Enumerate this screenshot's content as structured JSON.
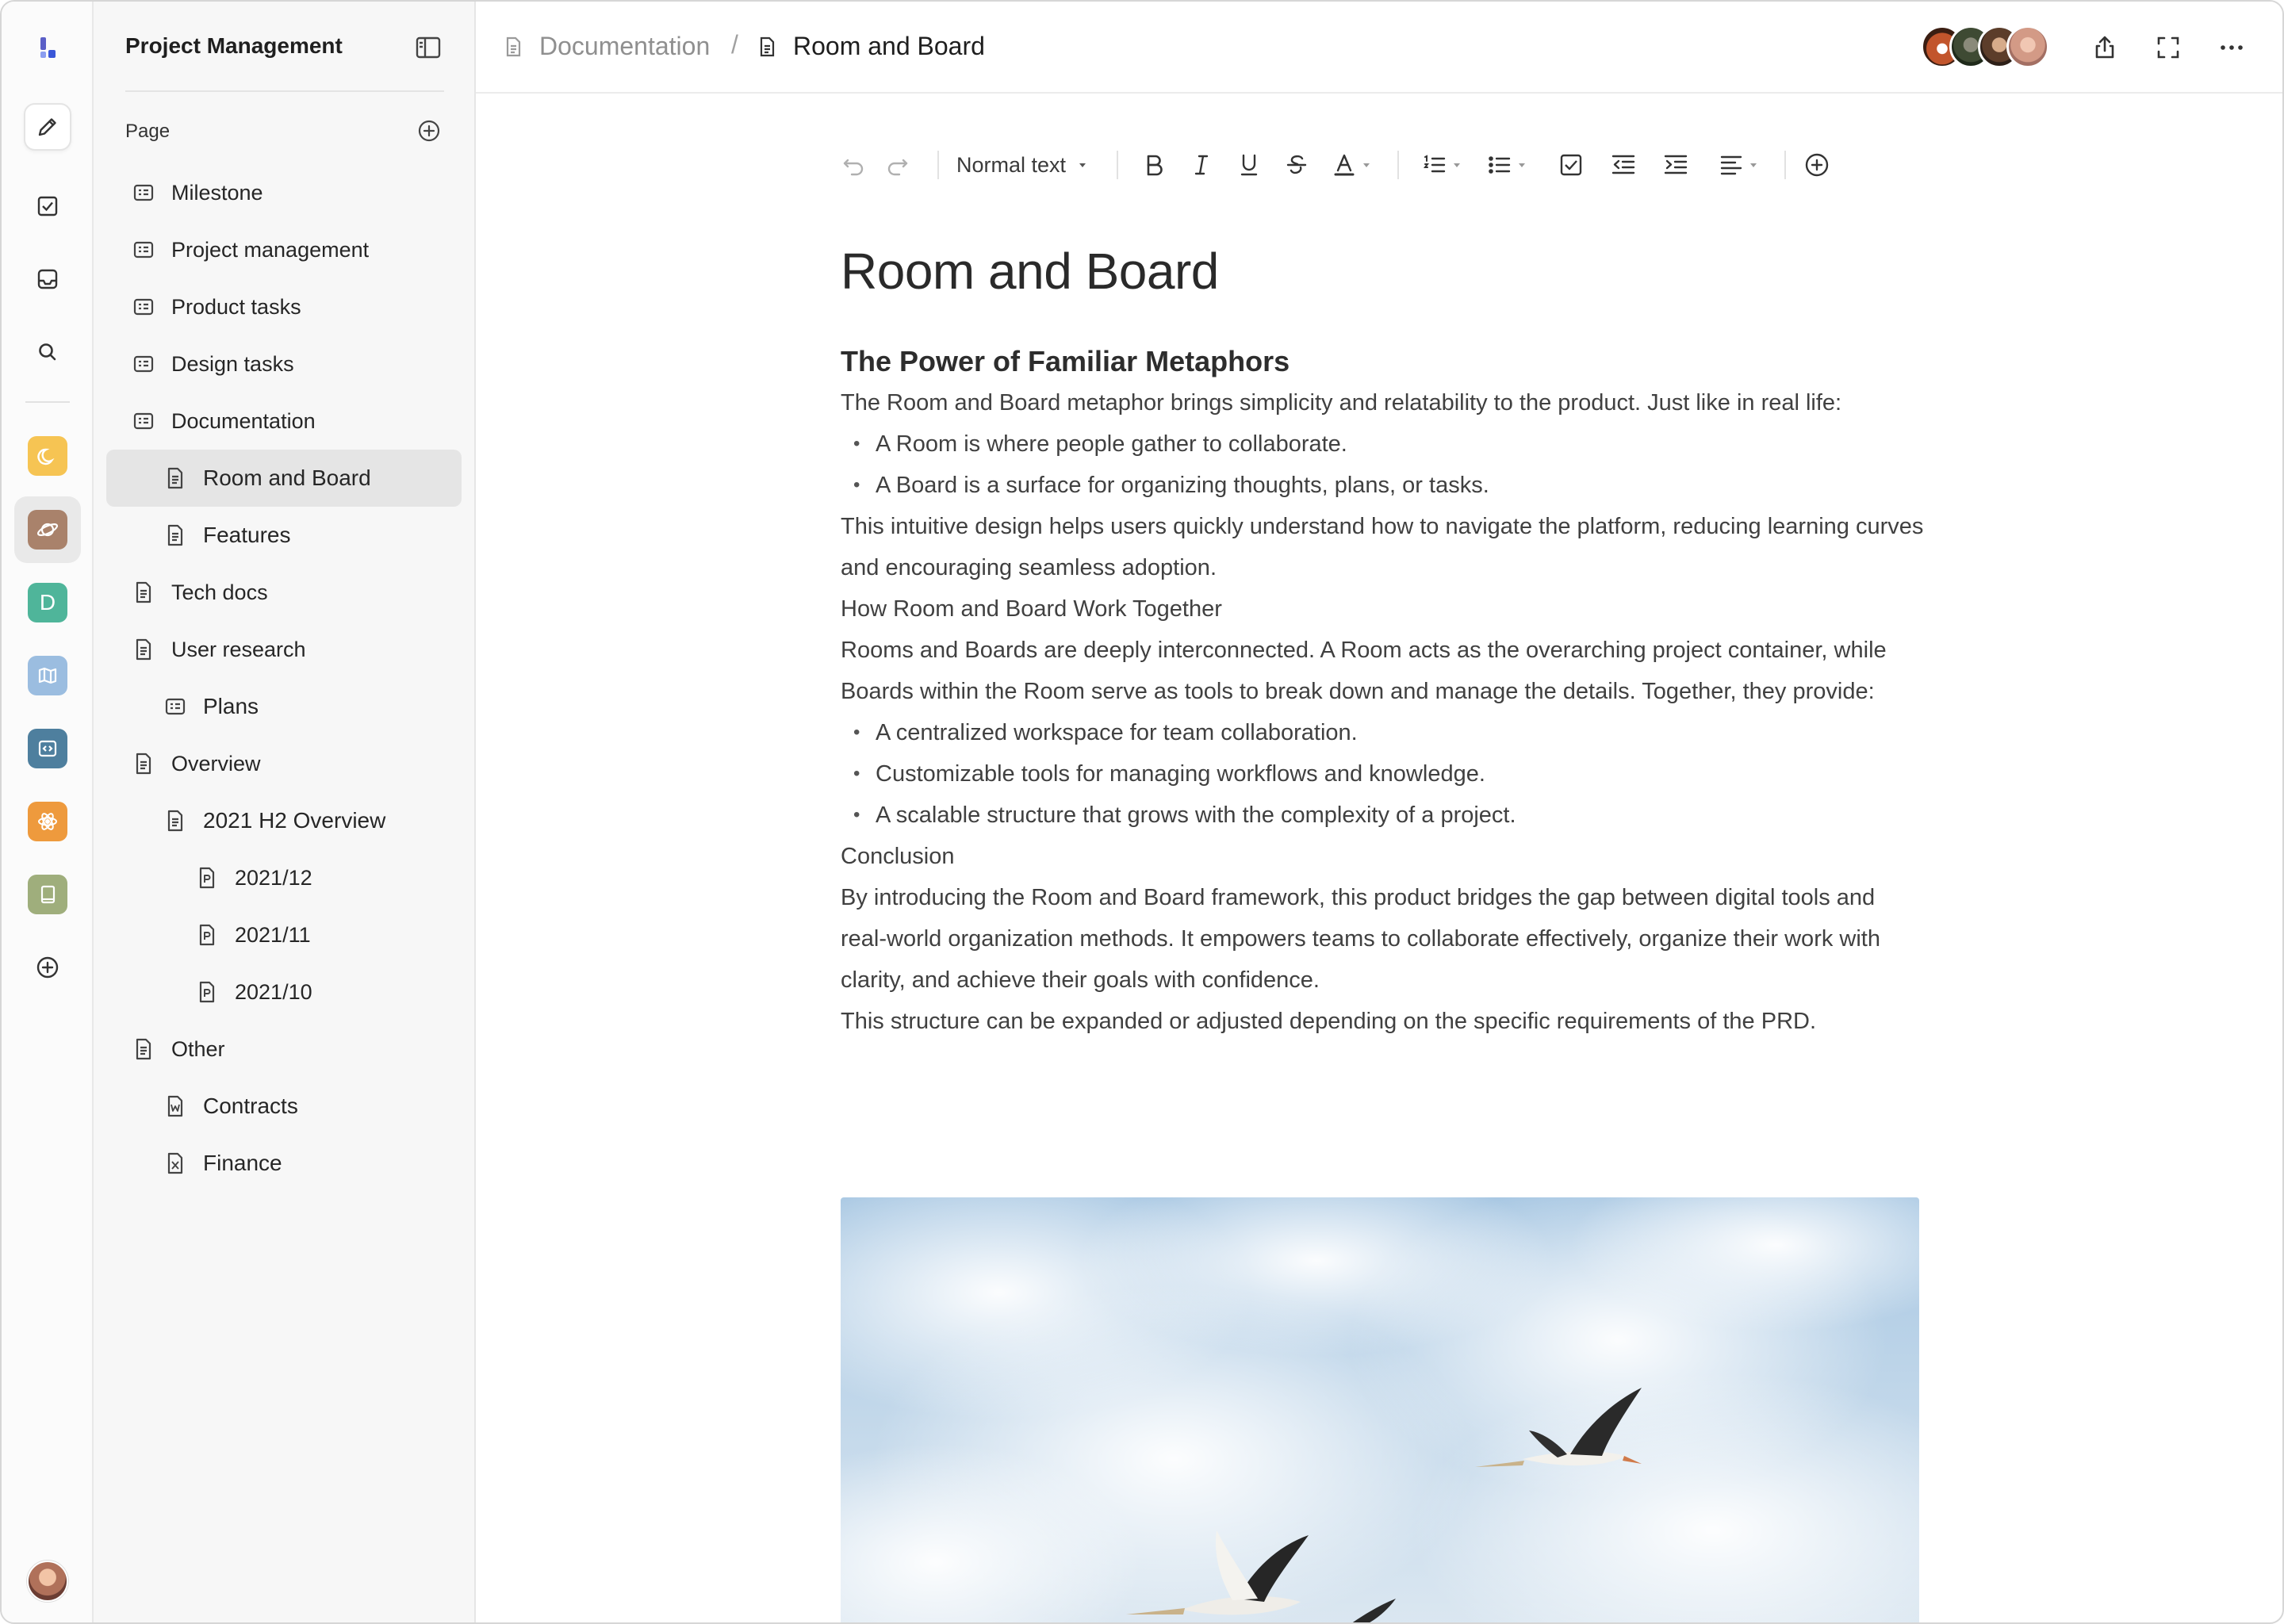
{
  "workspace": {
    "title": "Project Management"
  },
  "rail": {
    "items": [
      {
        "name": "logo"
      },
      {
        "name": "edit"
      },
      {
        "name": "tasks"
      },
      {
        "name": "inbox"
      },
      {
        "name": "search"
      }
    ],
    "spaces": [
      {
        "name": "moon-space",
        "color": "#f6c453"
      },
      {
        "name": "planet-space",
        "color": "#a9826b"
      },
      {
        "name": "d-space",
        "letter": "D",
        "color": "#4fb59a"
      },
      {
        "name": "map-space",
        "color": "#9bbde0"
      },
      {
        "name": "code-space",
        "color": "#4e7f9e"
      },
      {
        "name": "react-space",
        "color": "#ee9a3d"
      },
      {
        "name": "book-space",
        "color": "#9fae7c"
      }
    ]
  },
  "sidebar": {
    "section_label": "Page",
    "items": [
      {
        "label": "Milestone",
        "icon": "table",
        "level": 1
      },
      {
        "label": "Project management",
        "icon": "table",
        "level": 1
      },
      {
        "label": "Product tasks",
        "icon": "table",
        "level": 1
      },
      {
        "label": "Design tasks",
        "icon": "table",
        "level": 1
      },
      {
        "label": "Documentation",
        "icon": "table",
        "level": 1
      },
      {
        "label": "Room and Board",
        "icon": "doc",
        "level": 2,
        "selected": true
      },
      {
        "label": "Features",
        "icon": "doc",
        "level": 2
      },
      {
        "label": "Tech docs",
        "icon": "doc",
        "level": 1
      },
      {
        "label": "User research",
        "icon": "doc",
        "level": 1
      },
      {
        "label": "Plans",
        "icon": "table",
        "level": 2
      },
      {
        "label": "Overview",
        "icon": "doc",
        "level": 1
      },
      {
        "label": "2021 H2 Overview",
        "icon": "doc",
        "level": 2
      },
      {
        "label": "2021/12",
        "icon": "p",
        "level": 3
      },
      {
        "label": "2021/11",
        "icon": "p",
        "level": 3
      },
      {
        "label": "2021/10",
        "icon": "p",
        "level": 3
      },
      {
        "label": "Other",
        "icon": "doc",
        "level": 1
      },
      {
        "label": "Contracts",
        "icon": "w",
        "level": 2
      },
      {
        "label": "Finance",
        "icon": "x",
        "level": 2
      }
    ]
  },
  "breadcrumb": {
    "parent": "Documentation",
    "separator": "/",
    "current": "Room and Board"
  },
  "toolbar": {
    "text_style": "Normal text"
  },
  "document": {
    "title": "Room and Board",
    "heading": "The Power of Familiar Metaphors",
    "blocks": [
      {
        "type": "p",
        "text": "The Room and Board metaphor brings simplicity and relatability to the product. Just like in real life:"
      },
      {
        "type": "li",
        "text": "A Room is where people gather to collaborate."
      },
      {
        "type": "li",
        "text": "A Board is a surface for organizing thoughts, plans, or tasks."
      },
      {
        "type": "p",
        "text": "This intuitive design helps users quickly understand how to navigate the platform, reducing learning curves and encouraging seamless adoption."
      },
      {
        "type": "p",
        "text": "How Room and Board Work Together"
      },
      {
        "type": "p",
        "text": "Rooms and Boards are deeply interconnected. A Room acts as the overarching project container, while Boards within the Room serve as tools to break down and manage the details. Together, they provide:"
      },
      {
        "type": "li",
        "text": "A centralized workspace for team collaboration."
      },
      {
        "type": "li",
        "text": "Customizable tools for managing workflows and knowledge."
      },
      {
        "type": "li",
        "text": "A scalable structure that grows with the complexity of a project."
      },
      {
        "type": "p",
        "text": "Conclusion"
      },
      {
        "type": "p",
        "text": "By introducing the Room and Board framework, this product bridges the gap between digital tools and real-world organization methods. It empowers teams to collaborate effectively, organize their work with clarity, and achieve their goals with confidence."
      },
      {
        "type": "p",
        "text": "This structure can be expanded or adjusted depending on the specific requirements of the PRD."
      }
    ]
  }
}
